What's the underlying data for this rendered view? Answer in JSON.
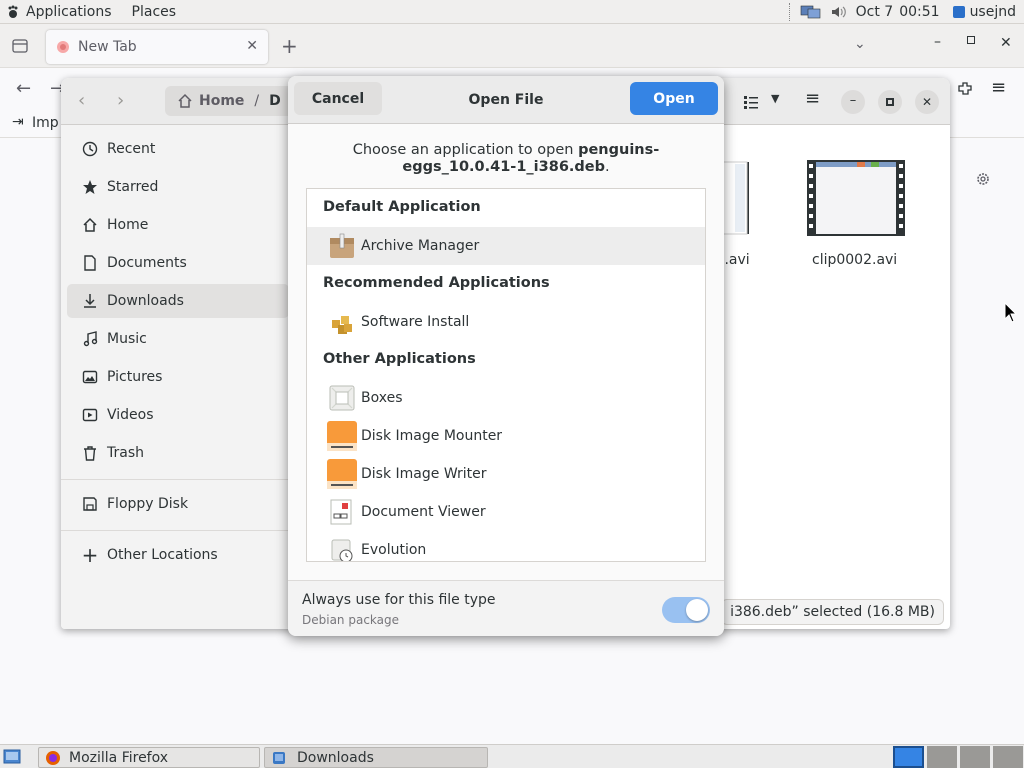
{
  "top_panel": {
    "applications": "Applications",
    "places": "Places",
    "date": "Oct 7",
    "time": "00:51",
    "user": "usejnd"
  },
  "firefox": {
    "tab_title": "New Tab",
    "bookmark_import": "Imp"
  },
  "files": {
    "path_home": "Home",
    "path_next": "D",
    "sidebar": [
      {
        "label": "Recent",
        "icon": "clock-icon"
      },
      {
        "label": "Starred",
        "icon": "star-icon"
      },
      {
        "label": "Home",
        "icon": "home-icon"
      },
      {
        "label": "Documents",
        "icon": "document-icon"
      },
      {
        "label": "Downloads",
        "icon": "download-icon"
      },
      {
        "label": "Music",
        "icon": "music-icon"
      },
      {
        "label": "Pictures",
        "icon": "picture-icon"
      },
      {
        "label": "Videos",
        "icon": "video-icon"
      },
      {
        "label": "Trash",
        "icon": "trash-icon"
      }
    ],
    "floppy": "Floppy Disk",
    "other_locations": "Other Locations",
    "files_grid": [
      {
        "name": ").avi"
      },
      {
        "name": "clip0002.avi"
      }
    ],
    "status": "i386.deb” selected (16.8 MB)"
  },
  "dialog": {
    "cancel": "Cancel",
    "title": "Open File",
    "open": "Open",
    "prompt_prefix": "Choose an application to open",
    "prompt_file": "penguins-eggs_10.0.41-1_i386.deb",
    "prompt_suffix": ".",
    "default_heading": "Default Application",
    "default_app": "Archive Manager",
    "recommended_heading": "Recommended Applications",
    "recommended_app": "Software Install",
    "other_heading": "Other Applications",
    "other_apps": [
      "Boxes",
      "Disk Image Mounter",
      "Disk Image Writer",
      "Document Viewer",
      "Evolution"
    ],
    "always_use": "Always use for this file type",
    "file_type": "Debian package",
    "toggle_on": true
  },
  "taskbar": {
    "firefox": "Mozilla Firefox",
    "downloads": "Downloads"
  },
  "colors": {
    "accent": "#3584e4",
    "toggle": "#99c1f1"
  }
}
